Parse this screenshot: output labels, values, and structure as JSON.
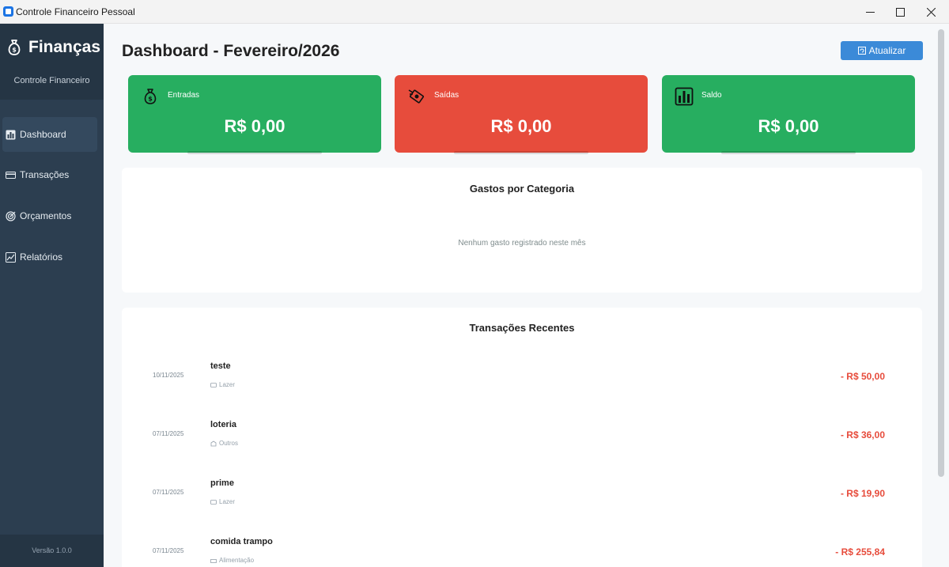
{
  "window": {
    "title": "Controle Financeiro Pessoal"
  },
  "sidebar": {
    "brand": "Finanças",
    "subtitle": "Controle Financeiro",
    "items": [
      {
        "label": "Dashboard",
        "icon": "bar-chart-icon",
        "active": true
      },
      {
        "label": "Transações",
        "icon": "credit-card-icon",
        "active": false
      },
      {
        "label": "Orçamentos",
        "icon": "target-icon",
        "active": false
      },
      {
        "label": "Relatórios",
        "icon": "line-chart-icon",
        "active": false
      }
    ],
    "version": "Versão 1.0.0"
  },
  "header": {
    "title": "Dashboard - Fevereiro/2026",
    "refresh_label": "Atualizar"
  },
  "summary": {
    "income": {
      "label": "Entradas",
      "value": "R$ 0,00",
      "color": "#27ae60",
      "icon": "money-bag-icon"
    },
    "expenses": {
      "label": "Saídas",
      "value": "R$ 0,00",
      "color": "#e74c3c",
      "icon": "money-with-wings-icon"
    },
    "balance": {
      "label": "Saldo",
      "value": "R$ 0,00",
      "color": "#27ae60",
      "icon": "bar-chart-icon"
    }
  },
  "category_panel": {
    "title": "Gastos por Categoria",
    "empty_message": "Nenhum gasto registrado neste mês"
  },
  "transactions_panel": {
    "title": "Transações Recentes",
    "rows": [
      {
        "date": "10/11/2025",
        "name": "teste",
        "category": "Lazer",
        "amount": "- R$ 50,00"
      },
      {
        "date": "07/11/2025",
        "name": "loteria",
        "category": "Outros",
        "amount": "- R$ 36,00"
      },
      {
        "date": "07/11/2025",
        "name": "prime",
        "category": "Lazer",
        "amount": "- R$ 19,90"
      },
      {
        "date": "07/11/2025",
        "name": "comida trampo",
        "category": "Alimentação",
        "amount": "- R$ 255,84"
      }
    ]
  }
}
